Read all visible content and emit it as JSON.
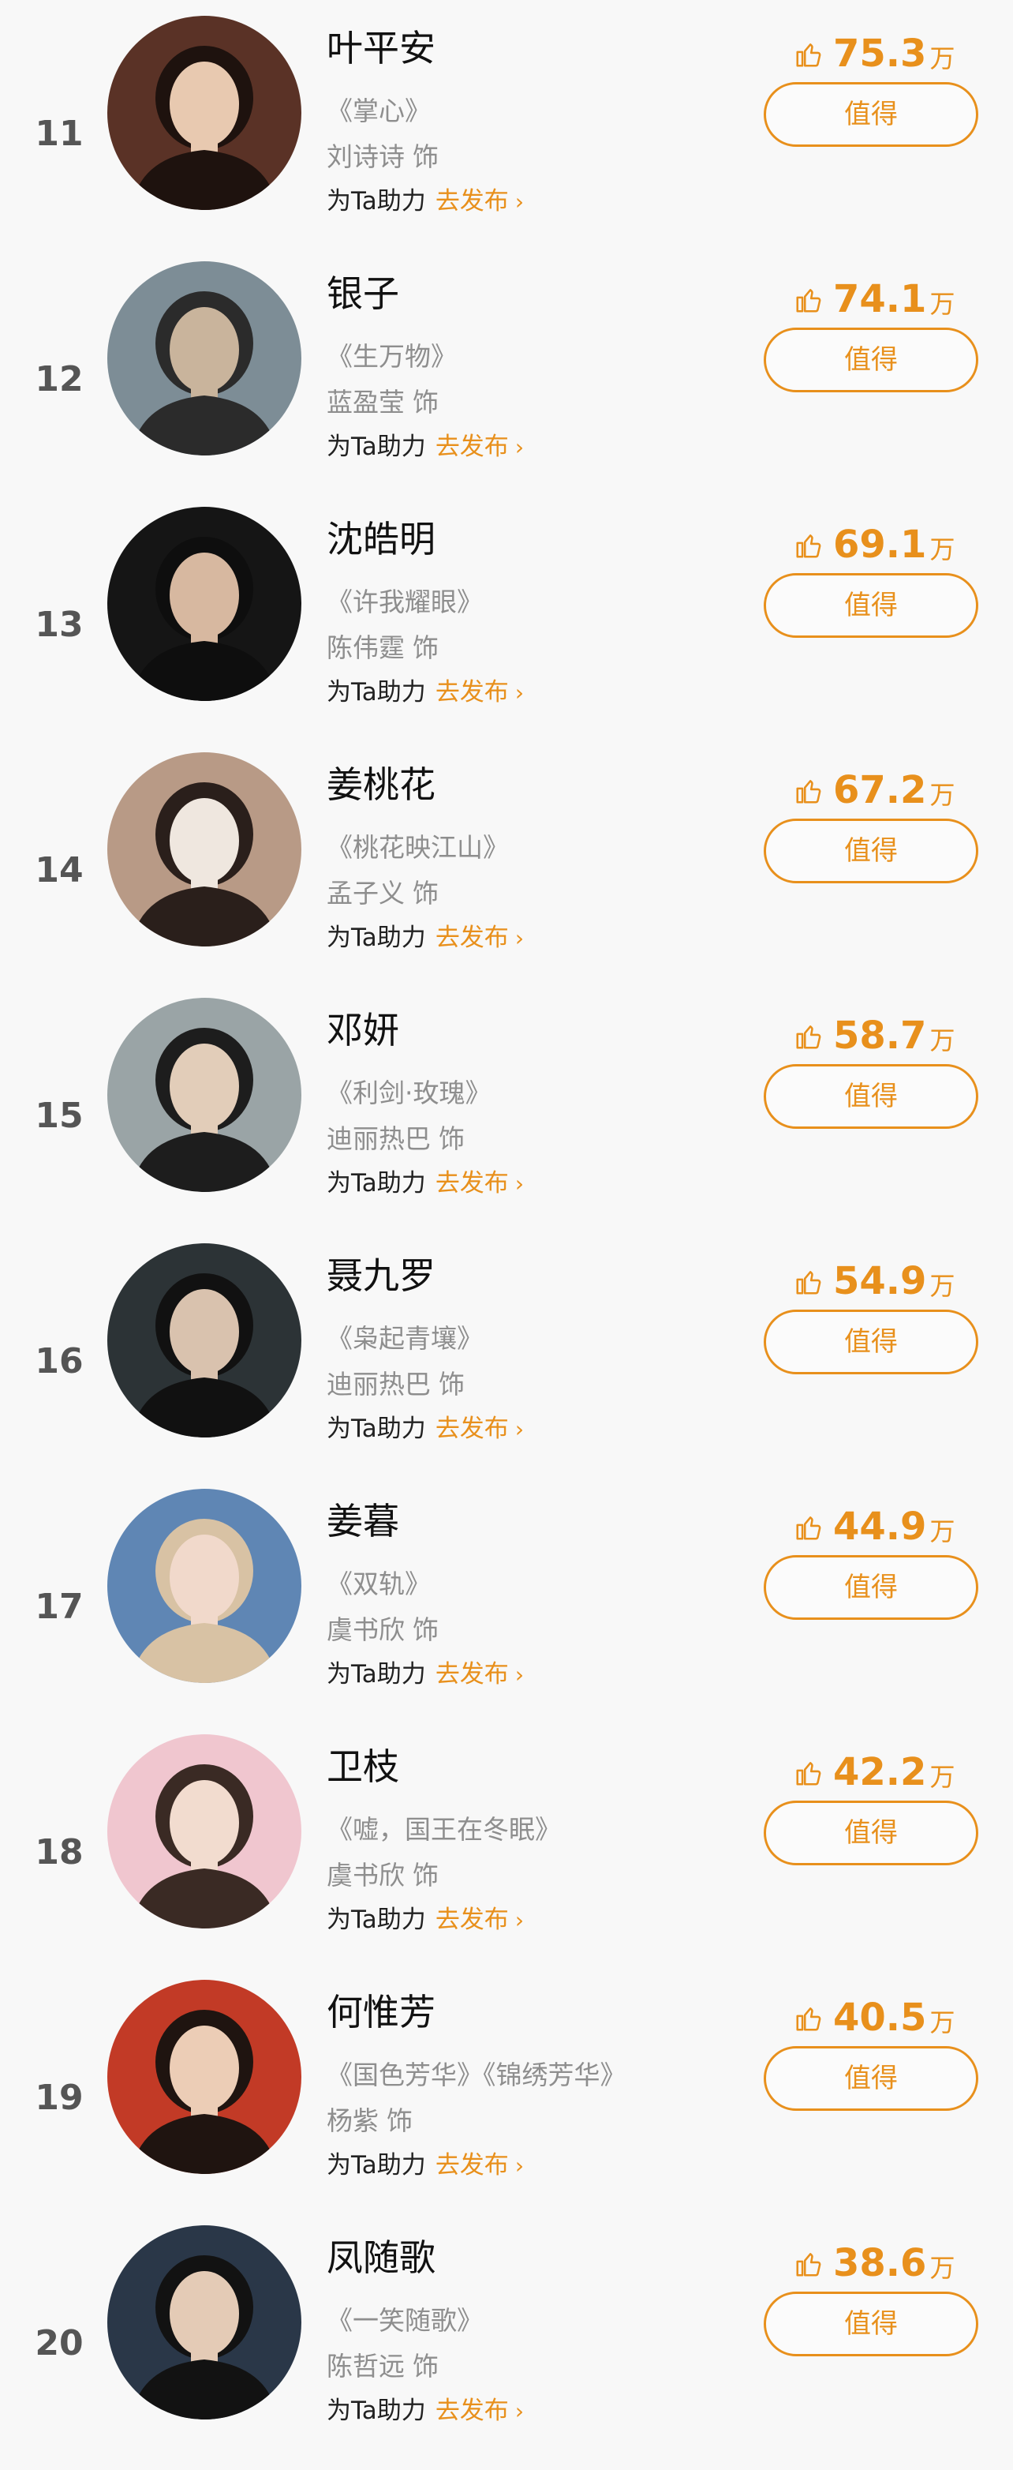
{
  "like_unit": "万",
  "support_label": "为Ta助力",
  "publish_label": "去发布",
  "publish_chevron": "›",
  "button_label": "值得",
  "actor_suffix": "饰",
  "accent_color": "#e8901c",
  "entries": [
    {
      "rank": "11",
      "name": "叶平安",
      "work": "《掌心》",
      "actor": "刘诗诗",
      "likes": "75.3",
      "avatar_bg": "#5a3226",
      "avatar_fg": "#e8c9b0",
      "avatar_hair": "#1e120e"
    },
    {
      "rank": "12",
      "name": "银子",
      "work": "《生万物》",
      "actor": "蓝盈莹",
      "likes": "74.1",
      "avatar_bg": "#7d8d96",
      "avatar_fg": "#c9b49c",
      "avatar_hair": "#2b2b2b"
    },
    {
      "rank": "13",
      "name": "沈皓明",
      "work": "《许我耀眼》",
      "actor": "陈伟霆",
      "likes": "69.1",
      "avatar_bg": "#151515",
      "avatar_fg": "#d7b8a0",
      "avatar_hair": "#0e0e0e"
    },
    {
      "rank": "14",
      "name": "姜桃花",
      "work": "《桃花映江山》",
      "actor": "孟子义",
      "likes": "67.2",
      "avatar_bg": "#b89a86",
      "avatar_fg": "#efe7df",
      "avatar_hair": "#2a1f1b"
    },
    {
      "rank": "15",
      "name": "邓妍",
      "work": "《利剑·玫瑰》",
      "actor": "迪丽热巴",
      "likes": "58.7",
      "avatar_bg": "#9aa4a6",
      "avatar_fg": "#e2cdb9",
      "avatar_hair": "#1d1d1d"
    },
    {
      "rank": "16",
      "name": "聂九罗",
      "work": "《枭起青壤》",
      "actor": "迪丽热巴",
      "likes": "54.9",
      "avatar_bg": "#2c3336",
      "avatar_fg": "#d9c2ae",
      "avatar_hair": "#111111"
    },
    {
      "rank": "17",
      "name": "姜暮",
      "work": "《双轨》",
      "actor": "虞书欣",
      "likes": "44.9",
      "avatar_bg": "#5f86b4",
      "avatar_fg": "#f1d9cb",
      "avatar_hair": "#d8c2a4"
    },
    {
      "rank": "18",
      "name": "卫枝",
      "work": "《嘘，国王在冬眠》",
      "actor": "虞书欣",
      "likes": "42.2",
      "avatar_bg": "#f0c6cf",
      "avatar_fg": "#f2dccf",
      "avatar_hair": "#3a2a24"
    },
    {
      "rank": "19",
      "name": "何惟芳",
      "work": "《国色芳华》《锦绣芳华》",
      "actor": "杨紫",
      "likes": "40.5",
      "avatar_bg": "#c23a26",
      "avatar_fg": "#eccdb6",
      "avatar_hair": "#1f1410"
    },
    {
      "rank": "20",
      "name": "凤随歌",
      "work": "《一笑随歌》",
      "actor": "陈哲远",
      "likes": "38.6",
      "avatar_bg": "#2a3748",
      "avatar_fg": "#e4cbb6",
      "avatar_hair": "#121212"
    }
  ]
}
